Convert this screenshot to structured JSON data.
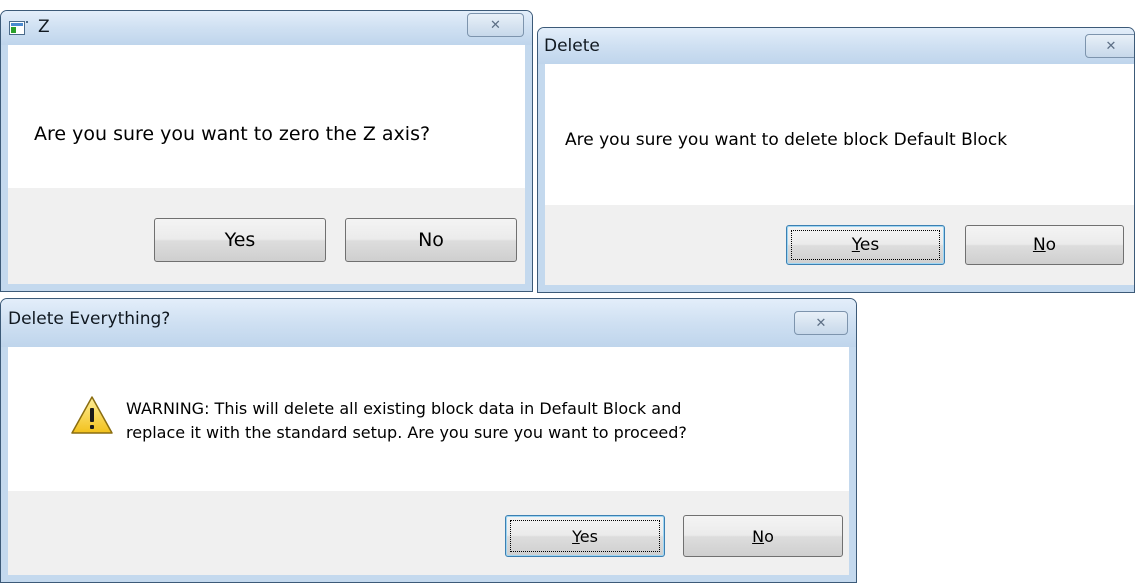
{
  "dialogs": {
    "zero_z": {
      "title": "Z",
      "message": "Are you sure you want to zero the Z axis?",
      "yes_label": "Yes",
      "no_label": "No",
      "close_icon": "close-icon"
    },
    "delete_block": {
      "title": "Delete",
      "message": "Are you sure you want to delete block Default Block",
      "yes_mnemonic": "Y",
      "yes_rest": "es",
      "no_mnemonic": "N",
      "no_rest": "o",
      "close_icon": "close-icon"
    },
    "delete_everything": {
      "title": "Delete Everything?",
      "message_line1": "WARNING: This will delete all existing block data in Default Block and",
      "message_line2": "replace it with the standard setup. Are you sure you want to proceed?",
      "yes_mnemonic": "Y",
      "yes_rest": "es",
      "no_mnemonic": "N",
      "no_rest": "o",
      "icon": "warning-icon",
      "close_icon": "close-icon"
    }
  },
  "colors": {
    "window_frame": "#c4d9ee",
    "dialog_footer": "#f0f0f0",
    "focus_border": "#3c7fb1",
    "warning_yellow": "#f7d13a"
  }
}
